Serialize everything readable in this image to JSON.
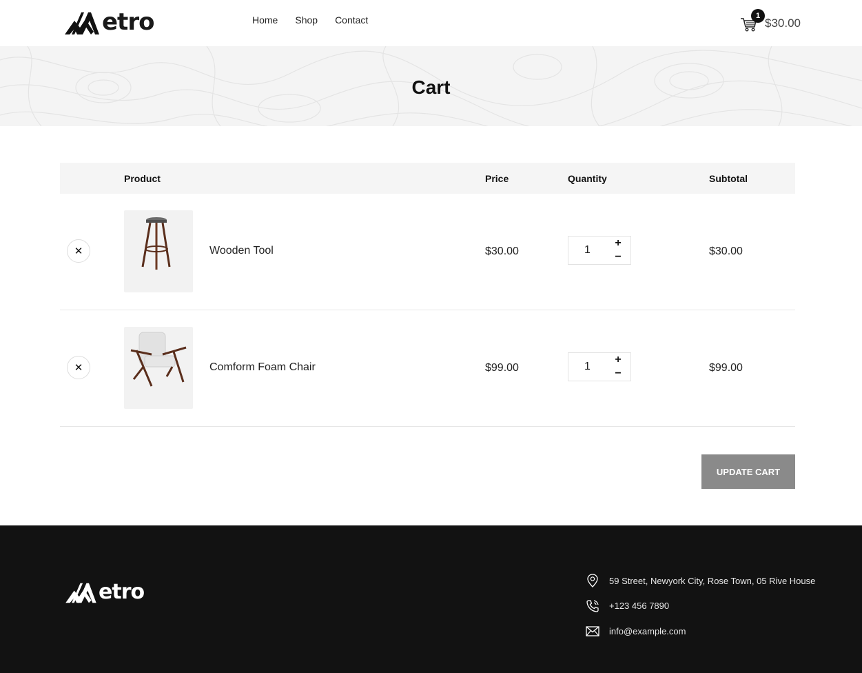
{
  "brand": {
    "name": "etro"
  },
  "nav": {
    "items": [
      "Home",
      "Shop",
      "Contact"
    ]
  },
  "cart_widget": {
    "count": "1",
    "total": "$30.00"
  },
  "banner": {
    "title": "Cart"
  },
  "table": {
    "headers": {
      "product": "Product",
      "price": "Price",
      "quantity": "Quantity",
      "subtotal": "Subtotal"
    },
    "rows": [
      {
        "remove": "✕",
        "name": "Wooden Tool",
        "price": "$30.00",
        "quantity": "1",
        "subtotal": "$30.00",
        "image": "bar-stool"
      },
      {
        "remove": "✕",
        "name": "Comform Foam Chair",
        "price": "$99.00",
        "quantity": "1",
        "subtotal": "$99.00",
        "image": "lounge-chair"
      }
    ],
    "plus_label": "+",
    "minus_label": "−"
  },
  "actions": {
    "update_cart": "Update Cart"
  },
  "footer": {
    "address": "59 Street, Newyork City, Rose Town, 05 Rive House",
    "phone": "+123 456 7890",
    "email": "info@example.com"
  },
  "icons": {
    "cart": "cart-icon",
    "location": "location-pin-icon",
    "phone": "phone-icon",
    "email": "envelope-icon"
  }
}
